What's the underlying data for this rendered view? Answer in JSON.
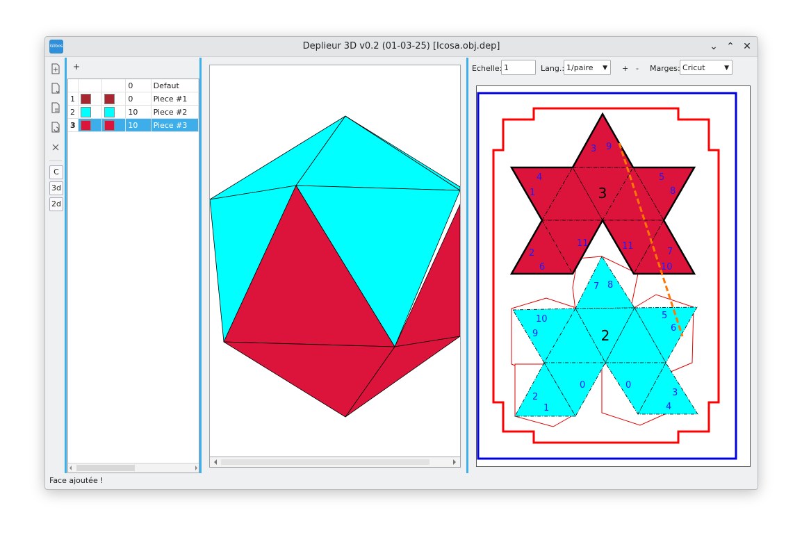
{
  "window": {
    "title": "Deplieur 3D v0.2 (01-03-25) [Icosa.obj.dep]",
    "app_icon_text": "Glibos",
    "controls": {
      "minimize": "⌄",
      "maximize": "⌃",
      "close": "✕"
    }
  },
  "left_toolbar": {
    "tools": [
      "new-page-icon",
      "open-file-icon",
      "import-file-icon",
      "save-file-icon",
      "close-icon"
    ],
    "modes": [
      "C",
      "3d",
      "2d"
    ]
  },
  "pieces_panel": {
    "add_label": "+",
    "header": {
      "num": "",
      "col1": "",
      "col2": "",
      "count": "0",
      "name": "Defaut"
    },
    "rows": [
      {
        "num": "1",
        "color1": "#a8262f",
        "color2": "#a8262f",
        "count": "0",
        "name": "Piece #1"
      },
      {
        "num": "2",
        "color1": "#00ffff",
        "color2": "#00ffff",
        "count": "10",
        "name": "Piece #2"
      },
      {
        "num": "3",
        "color1": "#dc143c",
        "color2": "#dc143c",
        "count": "10",
        "name": "Piece #3"
      }
    ],
    "selected_row": 3
  },
  "options": {
    "echelle_label": "Echelle:",
    "echelle_value": "1",
    "lang_label": "Lang.:",
    "lang_value": "1/paire",
    "plus_label": "+",
    "minus_label": "-",
    "marges_label": "Marges:",
    "marges_value": "Cricut"
  },
  "sheet": {
    "pieces": [
      {
        "label": "3",
        "color": "#dc143c"
      },
      {
        "label": "2",
        "color": "#00ffff"
      }
    ],
    "red_piece_edge_numbers": [
      "9",
      "3",
      "4",
      "1",
      "5",
      "8",
      "11",
      "11",
      "2",
      "6",
      "7",
      "10"
    ],
    "cyan_piece_edge_numbers": [
      "7",
      "8",
      "10",
      "9",
      "5",
      "6",
      "0",
      "0",
      "2",
      "1",
      "3",
      "4"
    ]
  },
  "status_text": "Face ajoutée !"
}
